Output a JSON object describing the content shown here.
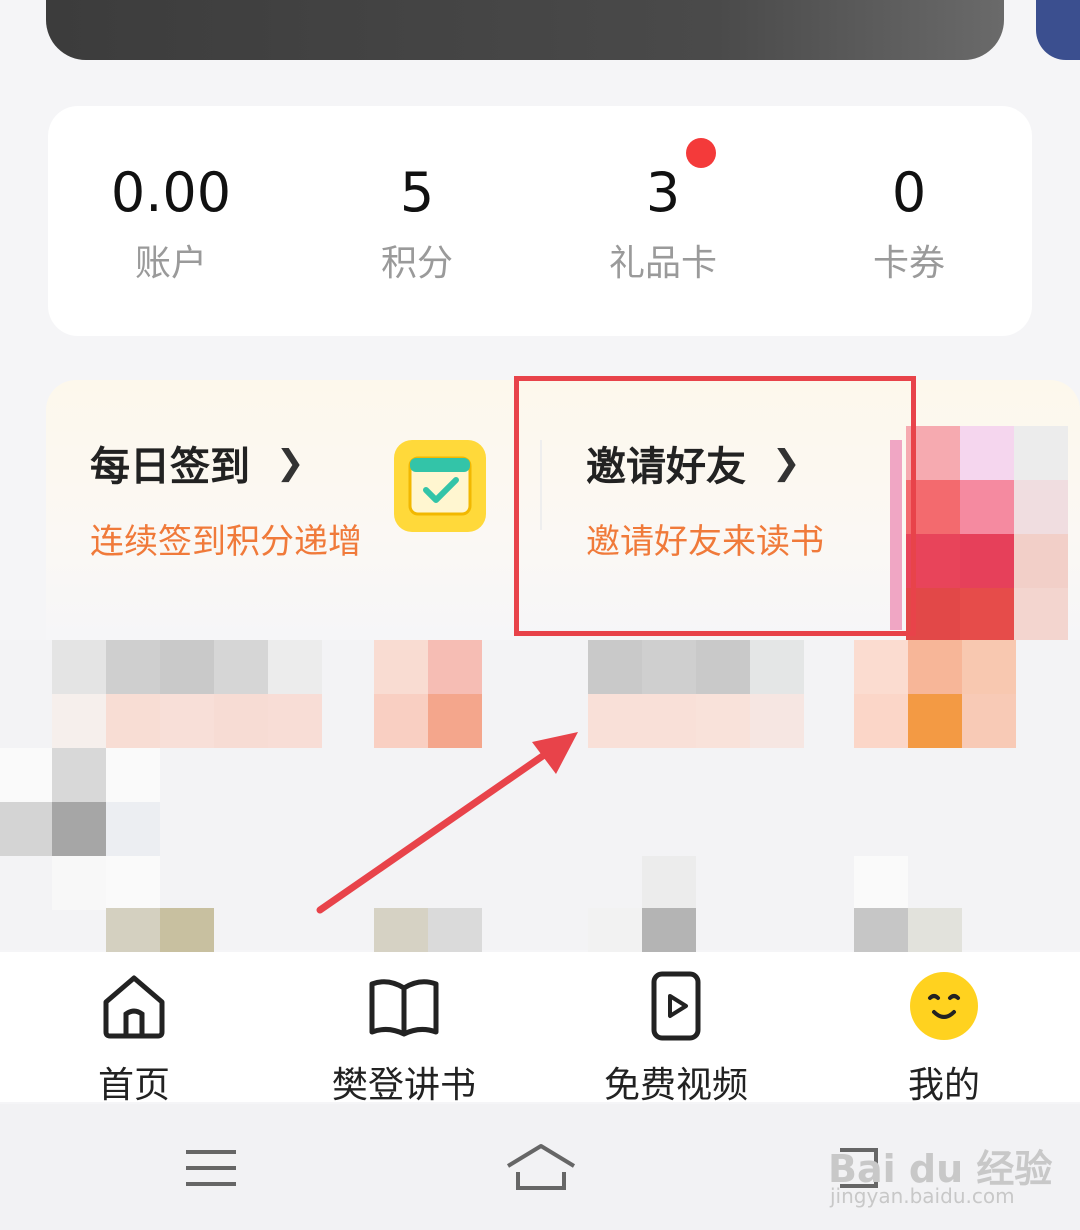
{
  "stats": [
    {
      "value": "0.00",
      "label": "账户"
    },
    {
      "value": "5",
      "label": "积分"
    },
    {
      "value": "3",
      "label": "礼品卡"
    },
    {
      "value": "0",
      "label": "卡券"
    }
  ],
  "features": [
    {
      "title": "每日签到",
      "subtitle": "连续签到积分递增"
    },
    {
      "title": "邀请好友",
      "subtitle": "邀请好友来读书"
    }
  ],
  "tabs": [
    {
      "label": "首页",
      "icon": "home-icon"
    },
    {
      "label": "樊登讲书",
      "icon": "book-icon"
    },
    {
      "label": "免费视频",
      "icon": "video-icon"
    },
    {
      "label": "我的",
      "icon": "smiley-avatar-icon"
    }
  ],
  "watermark": {
    "main": "Bai du 经验",
    "sub": "jingyan.baidu.com"
  },
  "colors": {
    "accent": "#f07a3a",
    "highlight": "#e8434a",
    "badge": "#f43a3a"
  }
}
